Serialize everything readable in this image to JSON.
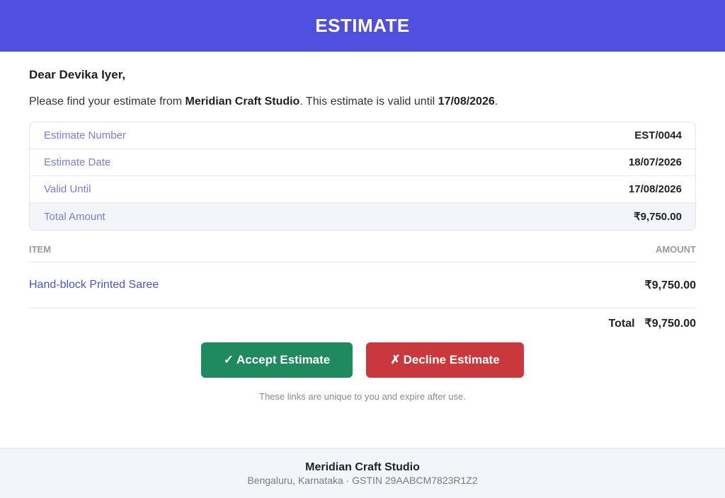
{
  "header": {
    "title": "ESTIMATE"
  },
  "greeting": "Dear Devika Iyer,",
  "intro": {
    "prefix": "Please find your estimate from ",
    "company": "Meridian Craft Studio",
    "middle": ". This estimate is valid until ",
    "valid_date": "17/08/2026",
    "suffix": "."
  },
  "summary": [
    {
      "label": "Estimate Number",
      "value": "EST/0044"
    },
    {
      "label": "Estimate Date",
      "value": "18/07/2026"
    },
    {
      "label": "Valid Until",
      "value": "17/08/2026"
    },
    {
      "label": "Total Amount",
      "value": "₹9,750.00"
    }
  ],
  "items": {
    "header_item": "ITEM",
    "header_amount": "AMOUNT",
    "rows": [
      {
        "name": "Hand-block Printed Saree",
        "amount": "₹9,750.00"
      }
    ],
    "total_label": "Total",
    "total_value": "₹9,750.00"
  },
  "actions": {
    "accept_icon": "✓",
    "accept_label": "Accept Estimate",
    "decline_icon": "✗",
    "decline_label": "Decline Estimate",
    "note": "These links are unique to you and expire after use."
  },
  "footer": {
    "company": "Meridian Craft Studio",
    "address": "Bengaluru, Karnataka · GSTIN 29AABCM7823R1Z2"
  },
  "colors": {
    "accent": "#4f50e0",
    "accept": "#1e8a5e",
    "decline": "#c8383d"
  }
}
